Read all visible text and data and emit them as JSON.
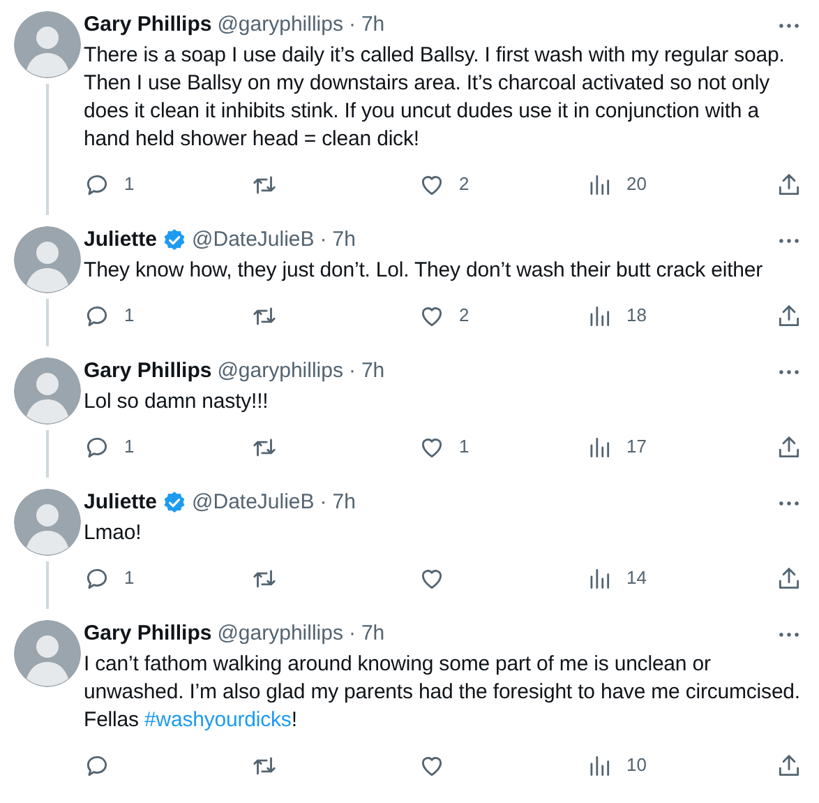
{
  "tweets": [
    {
      "author": "Gary Phillips",
      "verified": false,
      "handle": "@garyphillips",
      "separator": "·",
      "time": "7h",
      "thread_line": true,
      "body": [
        {
          "kind": "text",
          "text": "There is a soap I use daily it’s called Ballsy. I first wash with my regular soap. Then I use Ballsy on my downstairs area. It’s charcoal activated so not only does it clean it inhibits stink. If you uncut dudes use it in conjunction with a hand held shower head = clean dick!"
        }
      ],
      "stats": {
        "replies": "1",
        "likes": "2",
        "views": "20"
      }
    },
    {
      "author": "Juliette",
      "verified": true,
      "handle": "@DateJulieB",
      "separator": "·",
      "time": "7h",
      "thread_line": true,
      "body": [
        {
          "kind": "text",
          "text": "They know how, they just don’t. Lol. They don’t wash their butt crack either"
        }
      ],
      "stats": {
        "replies": "1",
        "likes": "2",
        "views": "18"
      }
    },
    {
      "author": "Gary Phillips",
      "verified": false,
      "handle": "@garyphillips",
      "separator": "·",
      "time": "7h",
      "thread_line": true,
      "body": [
        {
          "kind": "text",
          "text": "Lol so damn nasty!!!"
        }
      ],
      "stats": {
        "replies": "1",
        "likes": "1",
        "views": "17"
      }
    },
    {
      "author": "Juliette",
      "verified": true,
      "handle": "@DateJulieB",
      "separator": "·",
      "time": "7h",
      "thread_line": true,
      "body": [
        {
          "kind": "text",
          "text": "Lmao!"
        }
      ],
      "stats": {
        "replies": "1",
        "views": "14"
      }
    },
    {
      "author": "Gary Phillips",
      "verified": false,
      "handle": "@garyphillips",
      "separator": "·",
      "time": "7h",
      "thread_line": false,
      "body": [
        {
          "kind": "text",
          "text": "I can’t fathom walking around knowing some part of me is unclean or unwashed. I’m also glad my parents had the foresight to have me circumcised. Fellas "
        },
        {
          "kind": "hashtag",
          "text": "#washyourdicks"
        },
        {
          "kind": "text",
          "text": "!"
        }
      ],
      "stats": {
        "views": "10"
      }
    }
  ]
}
